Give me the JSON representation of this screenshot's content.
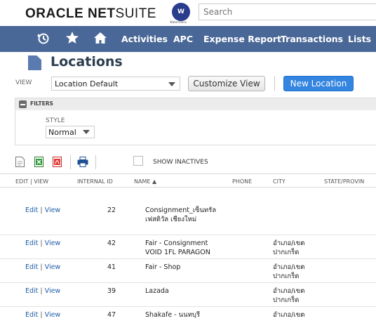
{
  "brand": {
    "logo_oracle": "ORACLE",
    "logo_net": "NET",
    "logo_suite": "SUITE",
    "badge_text": "W",
    "badge_sub": "Watermelon"
  },
  "search": {
    "placeholder": "Search"
  },
  "nav": {
    "items": [
      "Activities",
      "APC",
      "Expense Report",
      "Transactions",
      "Lists"
    ]
  },
  "page": {
    "title": "Locations"
  },
  "view": {
    "label": "VIEW",
    "selected": "Location Default",
    "customize_label": "Customize View",
    "new_label": "New Location"
  },
  "filters": {
    "header": "FILTERS",
    "style_label": "STYLE",
    "style_selected": "Normal"
  },
  "toolbar": {
    "show_inactives": "SHOW INACTIVES"
  },
  "table": {
    "headers": [
      "EDIT | VIEW",
      "INTERNAL ID",
      "NAME ▲",
      "PHONE",
      "CITY",
      "STATE/PROVIN"
    ],
    "edit_label": "Edit",
    "view_label": "View",
    "separator": "|",
    "rows": [
      {
        "id": "22",
        "name_l1": "Consignment_เซ็นทรัล",
        "name_l2": "เฟสติวัล เชียงใหม่",
        "phone": "",
        "city_l1": "",
        "city_l2": ""
      },
      {
        "id": "42",
        "name_l1": "Fair - Consignment",
        "name_l2": "VOID 1FL PARAGON",
        "phone": "",
        "city_l1": "อำเภอ/เขต",
        "city_l2": "ปากเกร็ด"
      },
      {
        "id": "41",
        "name_l1": "Fair - Shop",
        "name_l2": "",
        "phone": "",
        "city_l1": "อำเภอ/เขต",
        "city_l2": "ปากเกร็ด"
      },
      {
        "id": "39",
        "name_l1": "Lazada",
        "name_l2": "",
        "phone": "",
        "city_l1": "อำเภอ/เขต",
        "city_l2": "ปากเกร็ด"
      },
      {
        "id": "47",
        "name_l1": "Shakafe - นนทบุรี",
        "name_l2": "",
        "phone": "",
        "city_l1": "อำเภอ/เขต",
        "city_l2": ""
      }
    ]
  },
  "colors": {
    "nav_bg": "#4a6897",
    "accent_blue": "#3485e0",
    "link": "#1f5ea8",
    "title": "#2c3e50"
  }
}
